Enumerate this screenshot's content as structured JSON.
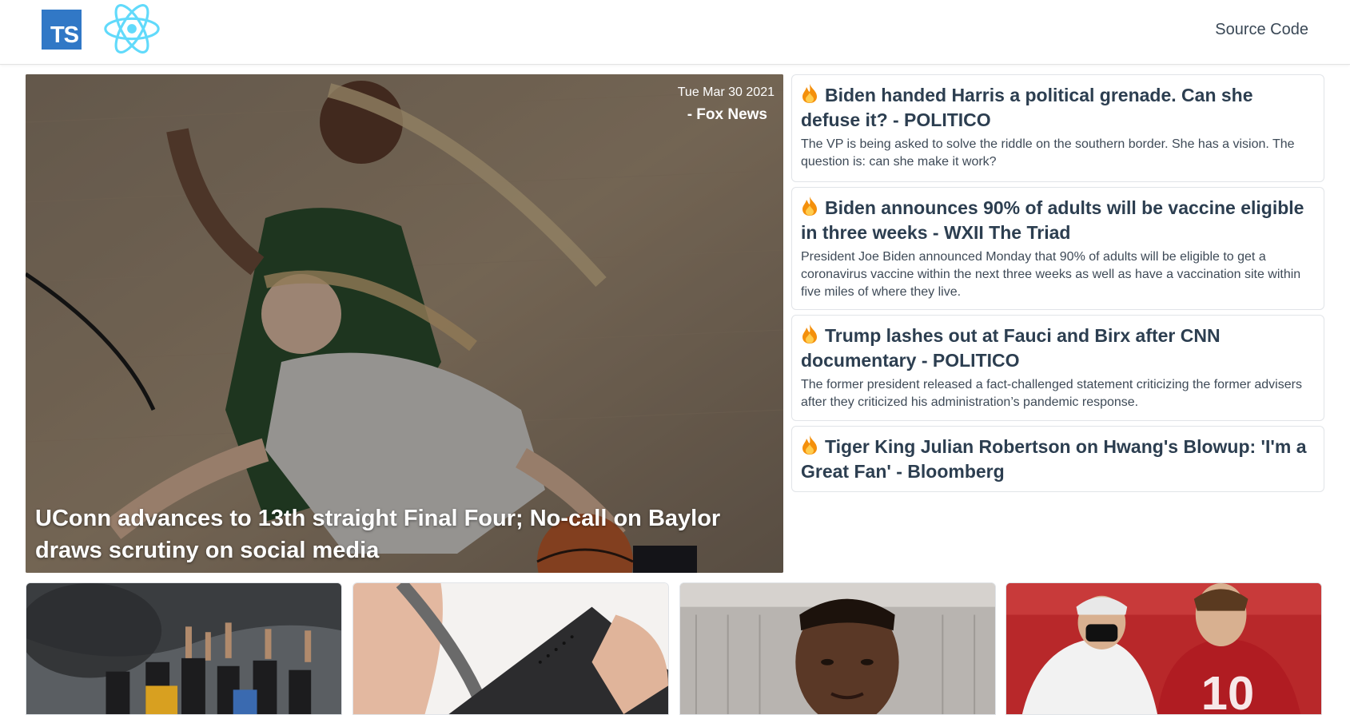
{
  "header": {
    "ts_logo_text": "TS",
    "react_logo_icon": "react-atom-icon",
    "source_code_label": "Source Code"
  },
  "hero": {
    "date": "Tue Mar 30 2021",
    "source": "- Fox News",
    "title": "UConn advances to 13th straight Final Four; No-call on Baylor draws scrutiny on social media"
  },
  "articles": [
    {
      "icon": "fire-icon",
      "title": "Biden handed Harris a political grenade. Can she defuse it? - POLITICO",
      "description": "The VP is being asked to solve the riddle on the southern border. She has a vision. The question is: can she make it work?"
    },
    {
      "icon": "fire-icon",
      "title": "Biden announces 90% of adults will be vaccine eligible in three weeks - WXII The Triad",
      "description": "President Joe Biden announced Monday that 90% of adults will be eligible to get a coronavirus vaccine within the next three weeks as well as have a vaccination site within five miles of where they live."
    },
    {
      "icon": "fire-icon",
      "title": "Trump lashes out at Fauci and Birx after CNN documentary - POLITICO",
      "description": "The former president released a fact-challenged statement criticizing the former advisers after they criticized his administration’s pandemic response."
    },
    {
      "icon": "fire-icon",
      "title": "Tiger King Julian Robertson on Hwang's Blowup: 'I'm a Great Fan' - Bloomberg",
      "description": ""
    }
  ],
  "colors": {
    "ts_blue": "#3178c6",
    "react_cyan": "#61dafb",
    "text_dark": "#2c3e50"
  }
}
